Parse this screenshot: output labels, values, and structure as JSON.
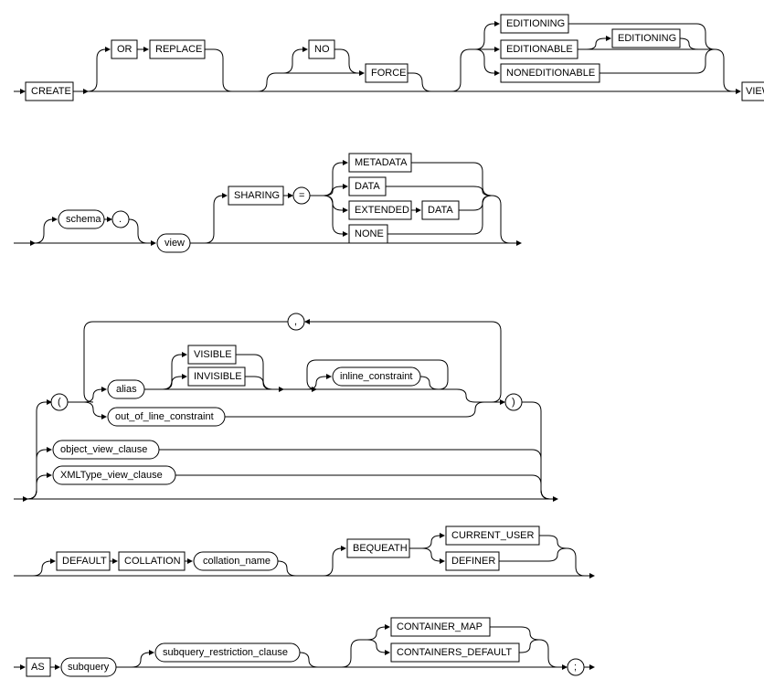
{
  "diagram": {
    "row1": {
      "create": "CREATE",
      "or": "OR",
      "replace": "REPLACE",
      "no": "NO",
      "force": "FORCE",
      "editioning": "EDITIONING",
      "editionable": "EDITIONABLE",
      "editioning2": "EDITIONING",
      "noneditionable": "NONEDITIONABLE",
      "view": "VIEW"
    },
    "row2": {
      "schema": "schema",
      "dot": ".",
      "view": "view",
      "sharing": "SHARING",
      "eq": "=",
      "metadata": "METADATA",
      "data": "DATA",
      "extended": "EXTENDED",
      "data2": "DATA",
      "none": "NONE"
    },
    "row3": {
      "lparen": "(",
      "comma": ",",
      "alias": "alias",
      "visible": "VISIBLE",
      "invisible": "INVISIBLE",
      "inline_constraint": "inline_constraint",
      "out_of_line_constraint": "out_of_line_constraint",
      "rparen": ")",
      "object_view_clause": "object_view_clause",
      "xmltype_view_clause": "XMLType_view_clause"
    },
    "row4": {
      "default": "DEFAULT",
      "collation": "COLLATION",
      "collation_name": "collation_name",
      "bequeath": "BEQUEATH",
      "current_user": "CURRENT_USER",
      "definer": "DEFINER"
    },
    "row5": {
      "as": "AS",
      "subquery": "subquery",
      "subquery_restriction_clause": "subquery_restriction_clause",
      "container_map": "CONTAINER_MAP",
      "containers_default": "CONTAINERS_DEFAULT",
      "semi": ";"
    }
  }
}
